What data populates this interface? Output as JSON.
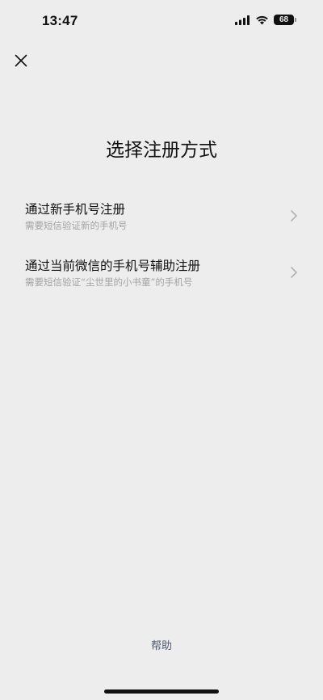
{
  "status_bar": {
    "time": "13:47",
    "battery": "68",
    "icons": [
      "signal-icon",
      "wifi-icon",
      "battery-icon"
    ]
  },
  "header": {
    "close_icon": "close-icon"
  },
  "title": "选择注册方式",
  "options": [
    {
      "title": "通过新手机号注册",
      "subtitle": "需要短信验证新的手机号",
      "icon": "chevron-right-icon"
    },
    {
      "title": "通过当前微信的手机号辅助注册",
      "subtitle": "需要短信验证“尘世里的小书童”的手机号",
      "icon": "chevron-right-icon"
    }
  ],
  "footer": {
    "help_label": "帮助"
  },
  "colors": {
    "background": "#ededed",
    "text_primary": "#111111",
    "text_secondary": "#a3a3a3",
    "link": "#4d5a73",
    "chevron": "#b2b2b2"
  }
}
